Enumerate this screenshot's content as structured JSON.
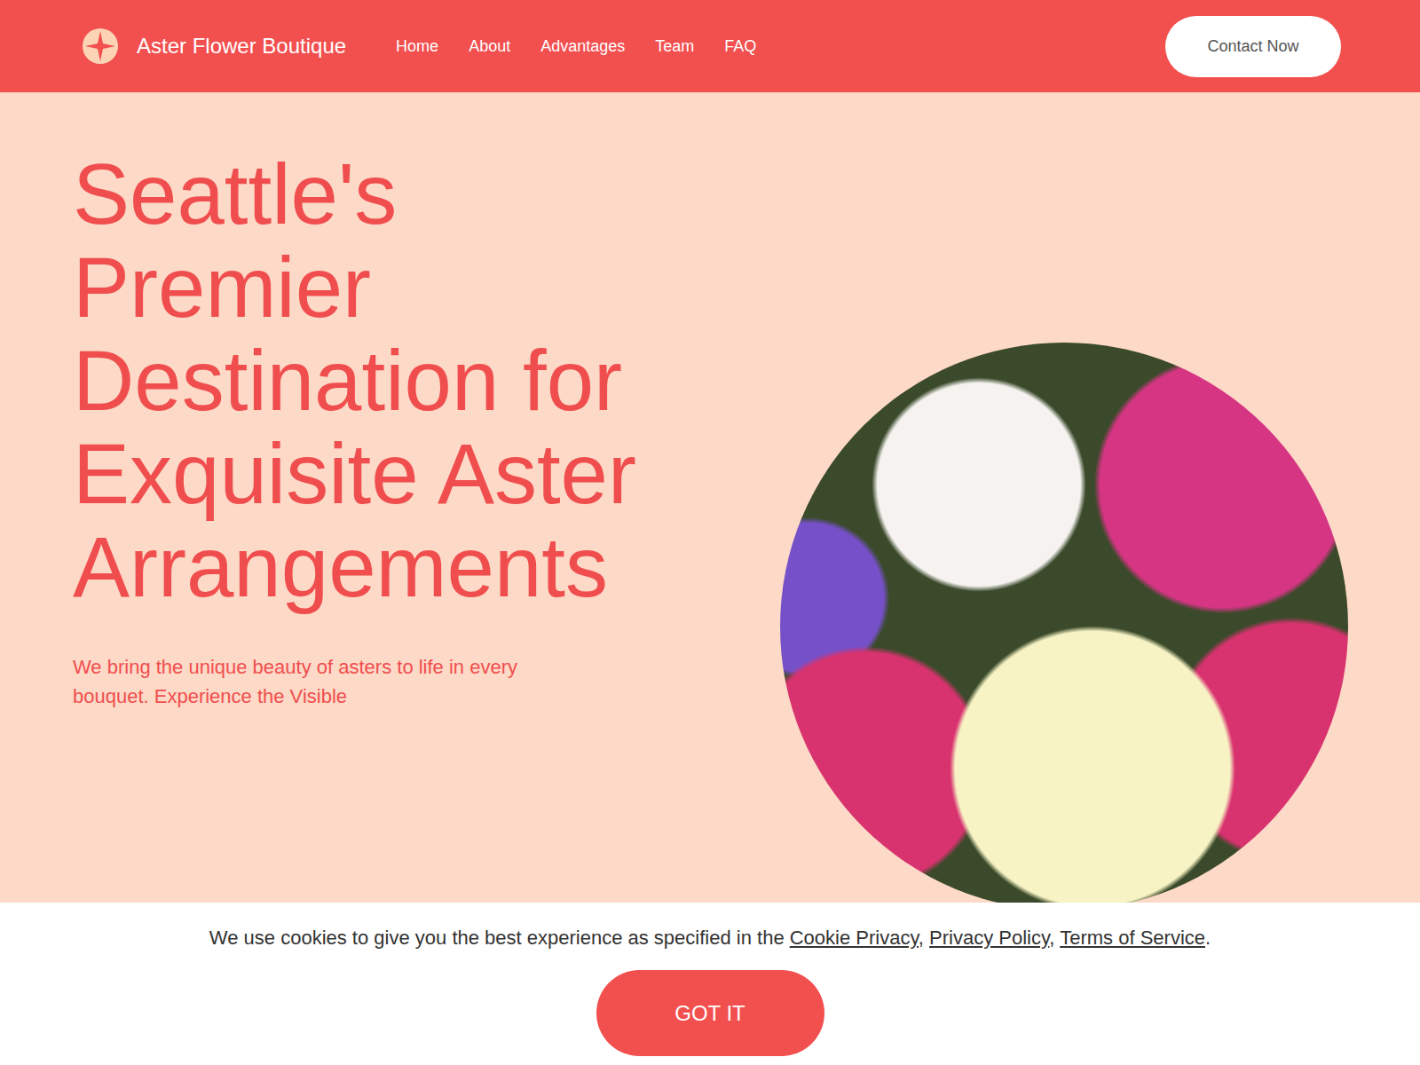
{
  "header": {
    "brand": "Aster Flower Boutique",
    "nav": [
      {
        "label": "Home"
      },
      {
        "label": "About"
      },
      {
        "label": "Advantages"
      },
      {
        "label": "Team"
      },
      {
        "label": "FAQ"
      }
    ],
    "cta": "Contact Now"
  },
  "hero": {
    "title": "Seattle's Premier Destination for Exquisite Aster Arrangements",
    "description": "We bring the unique beauty of asters to life in every bouquet. Experience the Visible"
  },
  "cookie_banner": {
    "text": "We use cookies to give you the best experience as specified in the ",
    "links": [
      {
        "label": "Cookie Privacy",
        "after": ", "
      },
      {
        "label": "Privacy Policy",
        "after": ", "
      },
      {
        "label": "Terms of Service",
        "after": "."
      }
    ],
    "button": "GOT IT"
  }
}
